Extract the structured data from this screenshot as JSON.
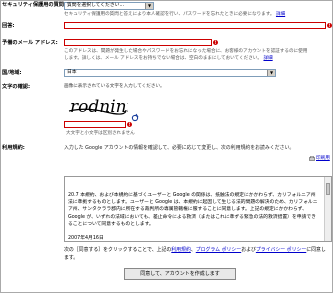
{
  "security": {
    "label": "セキュリティ保護用の質問:",
    "selected": "質問を選択してください...",
    "help": "セキュリティ保護用の質問と答えにより本人確認を行い、パスワードを忘れたときに必要になります。",
    "help_link": "詳細"
  },
  "answer": {
    "label": "回答:"
  },
  "recovery_email": {
    "label": "予備のメール アドレス:",
    "help_line1": "このアドレスは、間題が発生した場合やパスワードをお忘れになった場合に、お客様のアカウントを認証するのに使用",
    "help_line2": "します。詳しくは、メール アドレスをお持ちでない場合は、空白のままにしておいてください。",
    "help_link": "詳細"
  },
  "country": {
    "label": "国/地域:",
    "selected": "日本"
  },
  "captcha": {
    "label": "文字の確認:",
    "instruction": "画像に表示されている文字を入力してください。",
    "image_text": "rodnini",
    "audio_icon": "accessibility-audio-icon",
    "note": "大文字と小文字は区別されません"
  },
  "terms": {
    "label": "利用規約:",
    "intro": "入力した Google アカウントの情報を確認して、必要に応じて変更し、次の利用規約をお読みください。",
    "print_link": "印刷用",
    "body": "20.7 本規約、および本規約に基づくユーザーと Google の関係は、抵触法の規定にかかわらず、カリフォルニア州法に準拠するものとします。ユーザーと Google は、本規約に起因して生じる法的問題の解決のため、カリフォルニア州、サンタクララ郡内に所在する裁判所の専属管轄権に服することに同意します。上記の規定にかかわらず、Google が、いずれの法域においても、差止命令による救済（またはこれに準ずる緊急の法的救済措置）を申請できることについて同意するものとします。",
    "date": "2007年4月16日"
  },
  "agree": {
    "text_before": "次の［同意する］をクリックすることで、上記の",
    "tos_link": "利用規約",
    "text_mid1": "、",
    "program_link": "プログラム ポリシー",
    "text_mid2": "および",
    "privacy_link": "プライバシー ポリシー",
    "text_after": "に同意し",
    "text_line2": "ます。",
    "button": "同意して、アカウントを作成します"
  },
  "colors": {
    "error_red": "#cc0000",
    "link_blue": "#0000cc"
  }
}
